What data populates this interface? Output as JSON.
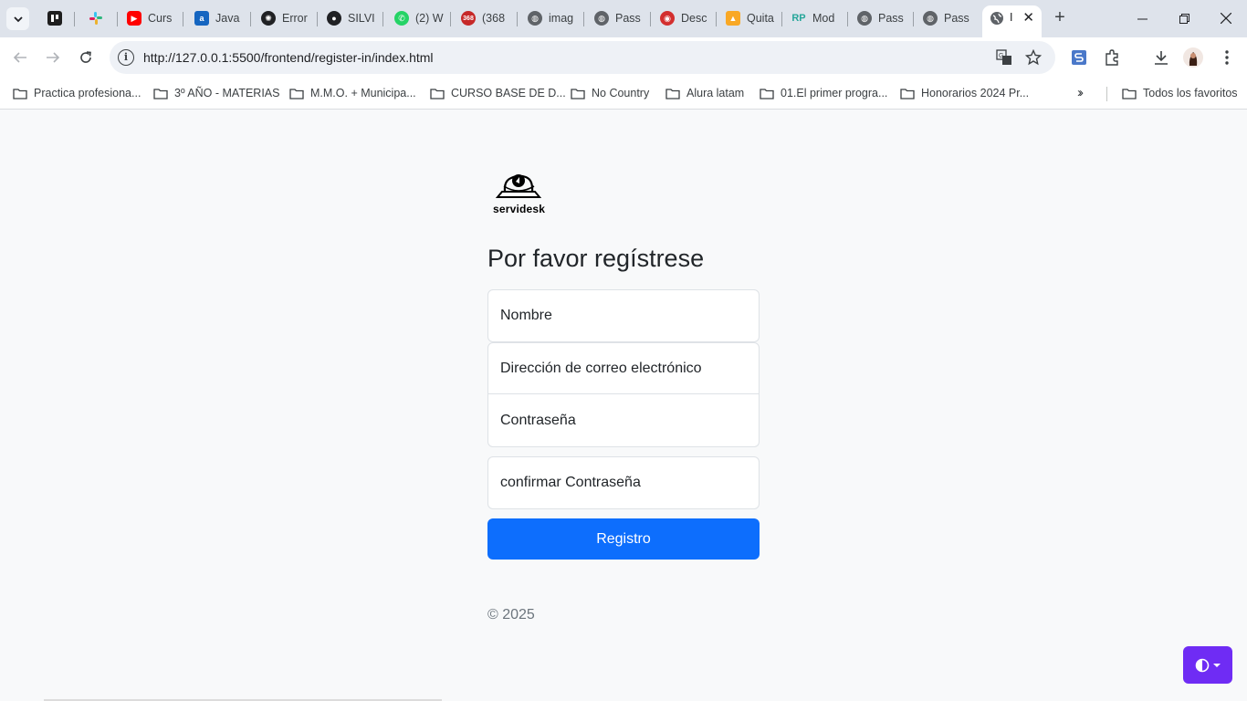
{
  "browser": {
    "tabs": [
      {
        "label": "",
        "icon": "trello-icon"
      },
      {
        "label": "",
        "icon": "slack-icon"
      },
      {
        "label": "Curs",
        "icon": "youtube-icon"
      },
      {
        "label": "Java",
        "icon": "alura-icon"
      },
      {
        "label": "Error",
        "icon": "openai-icon"
      },
      {
        "label": "SILVI",
        "icon": "github-icon"
      },
      {
        "label": "(2) W",
        "icon": "whatsapp-icon"
      },
      {
        "label": "(368",
        "icon": "mail-icon"
      },
      {
        "label": "imag",
        "icon": "globe-icon"
      },
      {
        "label": "Pass",
        "icon": "globe-icon"
      },
      {
        "label": "Desc",
        "icon": "lifebuoy-icon"
      },
      {
        "label": "Quita",
        "icon": "hat-icon"
      },
      {
        "label": "Mod",
        "icon": "rp-icon"
      },
      {
        "label": "Pass",
        "icon": "globe-icon"
      },
      {
        "label": "Pass",
        "icon": "globe-icon"
      }
    ],
    "active_tab": {
      "label": "I",
      "icon": "globe-icon"
    },
    "url": "http://127.0.0.1:5500/frontend/register-in/index.html",
    "bookmarks": [
      "Practica profesiona...",
      "3º AÑO - MATERIAS",
      "M.M.O. + Municipa...",
      "CURSO BASE DE D...",
      "No Country",
      "Alura latam",
      "01.El primer progra...",
      "Honorarios 2024 Pr..."
    ],
    "all_bookmarks": "Todos los favoritos"
  },
  "page": {
    "logo_text": "servidesk",
    "heading": "Por favor regístrese",
    "fields": {
      "name": "Nombre",
      "email": "Dirección de correo electrónico",
      "password": "Contraseña",
      "confirm": "confirmar Contraseña"
    },
    "submit": "Registro",
    "copyright": "© 2025"
  },
  "colors": {
    "primary": "#0d6efd",
    "theme_button": "#6f2cf4",
    "page_bg": "#f8f9fa"
  }
}
